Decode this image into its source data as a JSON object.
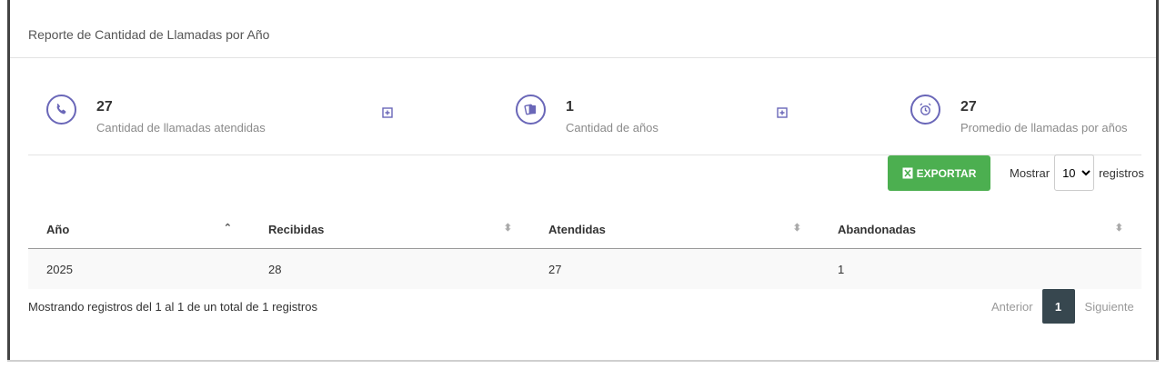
{
  "header": {
    "title": "Reporte de Cantidad de Llamadas por Año"
  },
  "stats": [
    {
      "value": "27",
      "label": "Cantidad de llamadas atendidas",
      "icon": "phone-icon"
    },
    {
      "value": "1",
      "label": "Cantidad de años",
      "icon": "cards-icon"
    },
    {
      "value": "27",
      "label": "Promedio de llamadas por años",
      "icon": "alarm-icon"
    }
  ],
  "colors": {
    "accent": "#6a67b8",
    "export": "#4caf50",
    "page_active": "#37474f"
  },
  "toolbar": {
    "export_label": "EXPORTAR",
    "show_label": "Mostrar",
    "page_size": "10",
    "records_label": "registros"
  },
  "table": {
    "headers": [
      "Año",
      "Recibidas",
      "Atendidas",
      "Abandonadas"
    ],
    "rows": [
      [
        "2025",
        "28",
        "27",
        "1"
      ]
    ]
  },
  "footer": {
    "info": "Mostrando registros del 1 al 1 de un total de 1 registros",
    "prev": "Anterior",
    "current_page": "1",
    "next": "Siguiente"
  }
}
